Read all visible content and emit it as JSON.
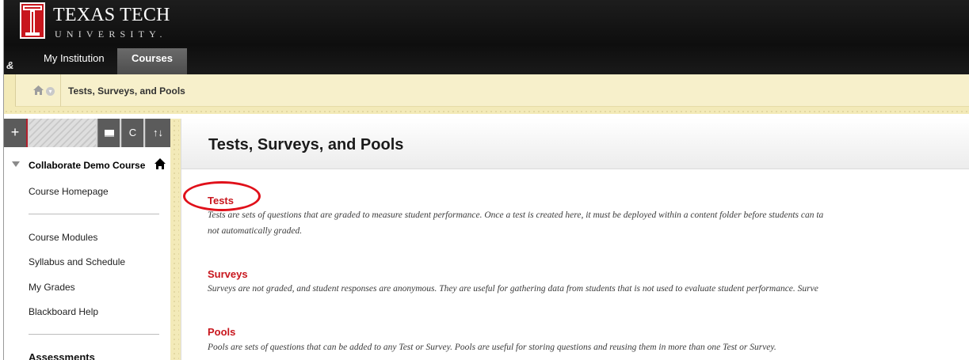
{
  "header": {
    "logo_line1": "TEXAS TECH",
    "logo_line2": "UNIVERSITY.",
    "tools_icon_glyph": "&",
    "tabs": [
      {
        "label": "My Institution"
      },
      {
        "label": "Courses"
      }
    ]
  },
  "breadcrumb": {
    "current": "Tests, Surveys, and Pools"
  },
  "toolbar": {
    "add_glyph": "+",
    "refresh_glyph": "C",
    "sort_glyph": "↑↓"
  },
  "menu": {
    "course_title": "Collaborate Demo Course",
    "links": {
      "course_homepage": "Course Homepage",
      "course_modules": "Course Modules",
      "syllabus": "Syllabus and Schedule",
      "grades": "My Grades",
      "help": "Blackboard Help"
    },
    "section_heading": "Assessments"
  },
  "main": {
    "title": "Tests, Surveys, and Pools",
    "sections": [
      {
        "link": "Tests",
        "description_line1": "Tests are sets of questions that are graded to measure student performance. Once a test is created here, it must be deployed within a content folder before students can ta",
        "description_line2": "not automatically graded."
      },
      {
        "link": "Surveys",
        "description_line1": "Surveys are not graded, and student responses are anonymous. They are useful for gathering data from students that is not used to evaluate student performance. Surve"
      },
      {
        "link": "Pools",
        "description_line1": "Pools are sets of questions that can be added to any Test or Survey. Pools are useful for storing questions and reusing them in more than one Test or Survey."
      }
    ]
  },
  "colors": {
    "accent_red": "#c8161d",
    "annotation_red": "#e0101a",
    "header_black": "#111111",
    "breadcrumb_tan": "#f3eab8"
  }
}
